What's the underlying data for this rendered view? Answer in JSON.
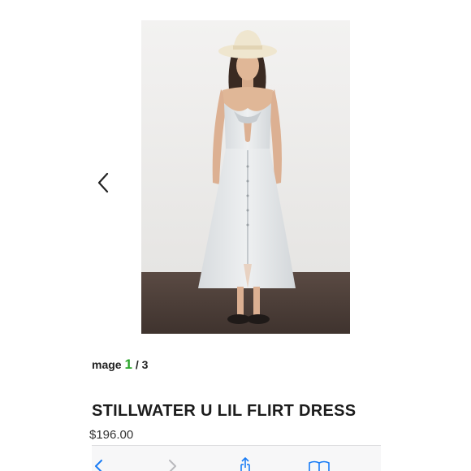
{
  "gallery": {
    "image_word": "mage",
    "current": "1",
    "separator": "/",
    "total": "3",
    "prev_icon": "chevron-left-icon"
  },
  "product": {
    "title": "STILLWATER U LIL FLIRT DRESS",
    "price": "$196.00"
  },
  "toolbar": {
    "back_icon": "chevron-left-icon",
    "forward_icon": "chevron-right-icon",
    "share_icon": "share-icon",
    "bookmarks_icon": "book-icon"
  },
  "colors": {
    "counter_accent": "#2aa52a",
    "ios_blue": "#1a7cf5",
    "disabled": "#b9b9bd"
  }
}
